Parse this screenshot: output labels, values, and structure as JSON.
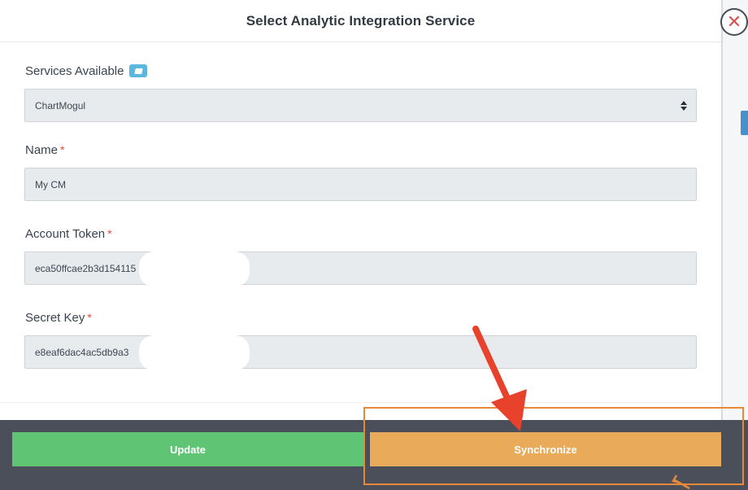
{
  "modal": {
    "title": "Select Analytic Integration Service",
    "close_glyph": "✕"
  },
  "form": {
    "services": {
      "label": "Services Available",
      "info_icon": "book-icon",
      "selected_value": "ChartMogul"
    },
    "name": {
      "label": "Name",
      "required_mark": "*",
      "value": "My CM"
    },
    "account_token": {
      "label": "Account Token",
      "required_mark": "*",
      "value": "eca50ffcae2b3d154115"
    },
    "secret_key": {
      "label": "Secret Key",
      "required_mark": "*",
      "value": "e8eaf6dac4ac5db9a3"
    }
  },
  "footer": {
    "update_label": "Update",
    "synchronize_label": "Synchronize"
  },
  "colors": {
    "update_button": "#5fc474",
    "synchronize_button": "#e9aa59",
    "required": "#e0493b",
    "annotation_arrow": "#e8412c",
    "annotation_box": "#e8893a"
  }
}
